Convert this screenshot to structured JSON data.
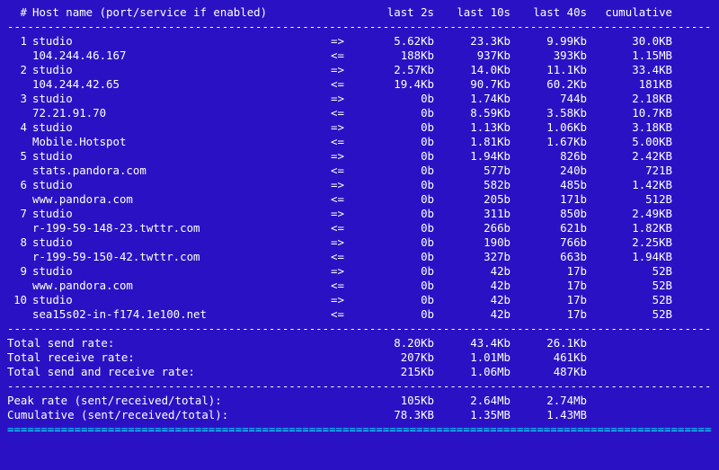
{
  "header": {
    "idx": "#",
    "hostname": "Host name (port/service if enabled)",
    "last2s": "last 2s",
    "last10s": "last 10s",
    "last40s": "last 40s",
    "cumulative": "cumulative"
  },
  "rows": [
    {
      "idx": "1",
      "host": "studio",
      "dir": "=>",
      "c2": "5.62Kb",
      "c10": "23.3Kb",
      "c40": "9.99Kb",
      "cum": "30.0KB"
    },
    {
      "idx": "",
      "host": "104.244.46.167",
      "dir": "<=",
      "c2": "188Kb",
      "c10": "937Kb",
      "c40": "393Kb",
      "cum": "1.15MB"
    },
    {
      "idx": "2",
      "host": "studio",
      "dir": "=>",
      "c2": "2.57Kb",
      "c10": "14.0Kb",
      "c40": "11.1Kb",
      "cum": "33.4KB"
    },
    {
      "idx": "",
      "host": "104.244.42.65",
      "dir": "<=",
      "c2": "19.4Kb",
      "c10": "90.7Kb",
      "c40": "60.2Kb",
      "cum": "181KB"
    },
    {
      "idx": "3",
      "host": "studio",
      "dir": "=>",
      "c2": "0b",
      "c10": "1.74Kb",
      "c40": "744b",
      "cum": "2.18KB"
    },
    {
      "idx": "",
      "host": "72.21.91.70",
      "dir": "<=",
      "c2": "0b",
      "c10": "8.59Kb",
      "c40": "3.58Kb",
      "cum": "10.7KB"
    },
    {
      "idx": "4",
      "host": "studio",
      "dir": "=>",
      "c2": "0b",
      "c10": "1.13Kb",
      "c40": "1.06Kb",
      "cum": "3.18KB"
    },
    {
      "idx": "",
      "host": "Mobile.Hotspot",
      "dir": "<=",
      "c2": "0b",
      "c10": "1.81Kb",
      "c40": "1.67Kb",
      "cum": "5.00KB"
    },
    {
      "idx": "5",
      "host": "studio",
      "dir": "=>",
      "c2": "0b",
      "c10": "1.94Kb",
      "c40": "826b",
      "cum": "2.42KB"
    },
    {
      "idx": "",
      "host": "stats.pandora.com",
      "dir": "<=",
      "c2": "0b",
      "c10": "577b",
      "c40": "240b",
      "cum": "721B"
    },
    {
      "idx": "6",
      "host": "studio",
      "dir": "=>",
      "c2": "0b",
      "c10": "582b",
      "c40": "485b",
      "cum": "1.42KB"
    },
    {
      "idx": "",
      "host": "www.pandora.com",
      "dir": "<=",
      "c2": "0b",
      "c10": "205b",
      "c40": "171b",
      "cum": "512B"
    },
    {
      "idx": "7",
      "host": "studio",
      "dir": "=>",
      "c2": "0b",
      "c10": "311b",
      "c40": "850b",
      "cum": "2.49KB"
    },
    {
      "idx": "",
      "host": "r-199-59-148-23.twttr.com",
      "dir": "<=",
      "c2": "0b",
      "c10": "266b",
      "c40": "621b",
      "cum": "1.82KB"
    },
    {
      "idx": "8",
      "host": "studio",
      "dir": "=>",
      "c2": "0b",
      "c10": "190b",
      "c40": "766b",
      "cum": "2.25KB"
    },
    {
      "idx": "",
      "host": "r-199-59-150-42.twttr.com",
      "dir": "<=",
      "c2": "0b",
      "c10": "327b",
      "c40": "663b",
      "cum": "1.94KB"
    },
    {
      "idx": "9",
      "host": "studio",
      "dir": "=>",
      "c2": "0b",
      "c10": "42b",
      "c40": "17b",
      "cum": "52B"
    },
    {
      "idx": "",
      "host": "www.pandora.com",
      "dir": "<=",
      "c2": "0b",
      "c10": "42b",
      "c40": "17b",
      "cum": "52B"
    },
    {
      "idx": "10",
      "host": "studio",
      "dir": "=>",
      "c2": "0b",
      "c10": "42b",
      "c40": "17b",
      "cum": "52B"
    },
    {
      "idx": "",
      "host": "sea15s02-in-f174.1e100.net",
      "dir": "<=",
      "c2": "0b",
      "c10": "42b",
      "c40": "17b",
      "cum": "52B"
    }
  ],
  "totals": {
    "send": {
      "label": "Total send rate:",
      "v1": "8.20Kb",
      "v2": "43.4Kb",
      "v3": "26.1Kb",
      "v4": ""
    },
    "recv": {
      "label": "Total receive rate:",
      "v1": "207Kb",
      "v2": "1.01Mb",
      "v3": "461Kb",
      "v4": ""
    },
    "both": {
      "label": "Total send and receive rate:",
      "v1": "215Kb",
      "v2": "1.06Mb",
      "v3": "487Kb",
      "v4": ""
    }
  },
  "peaks": {
    "peak": {
      "label": "Peak rate (sent/received/total):",
      "v1": "105Kb",
      "v2": "2.64Mb",
      "v3": "2.74Mb",
      "v4": ""
    },
    "cum": {
      "label": "Cumulative (sent/received/total):",
      "v1": "78.3KB",
      "v2": "1.35MB",
      "v3": "1.43MB",
      "v4": ""
    }
  },
  "sep": {
    "dashes": "--------------------------------------------------------------------------------------------------------------",
    "doubles": "=============================================================================================================="
  }
}
